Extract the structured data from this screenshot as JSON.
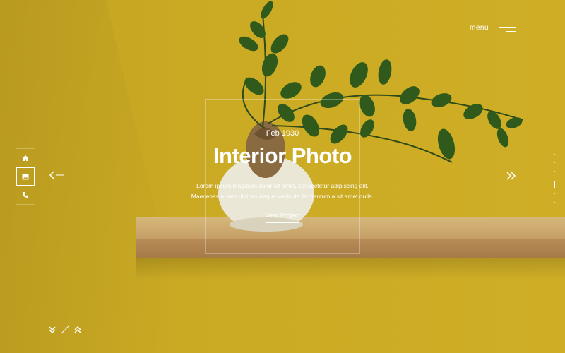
{
  "header": {
    "menu_label": "menu"
  },
  "side_nav": {
    "items": [
      "home-icon",
      "image-icon",
      "phone-icon"
    ],
    "active_index": 1
  },
  "slide": {
    "date": "Feb 1930",
    "title": "Interior Photo",
    "description_lines": [
      "Lorem ipsum magicum dolor sit amet, consectetur adipiscing elit.",
      "Maecenas a sem ultrices neque vehicula fermentum a sit amet nulla."
    ],
    "cta_label": "View Project"
  },
  "pagination": {
    "count": 6,
    "active_index": 3
  },
  "colors": {
    "background": "#c9a923",
    "text": "#ffffff"
  }
}
